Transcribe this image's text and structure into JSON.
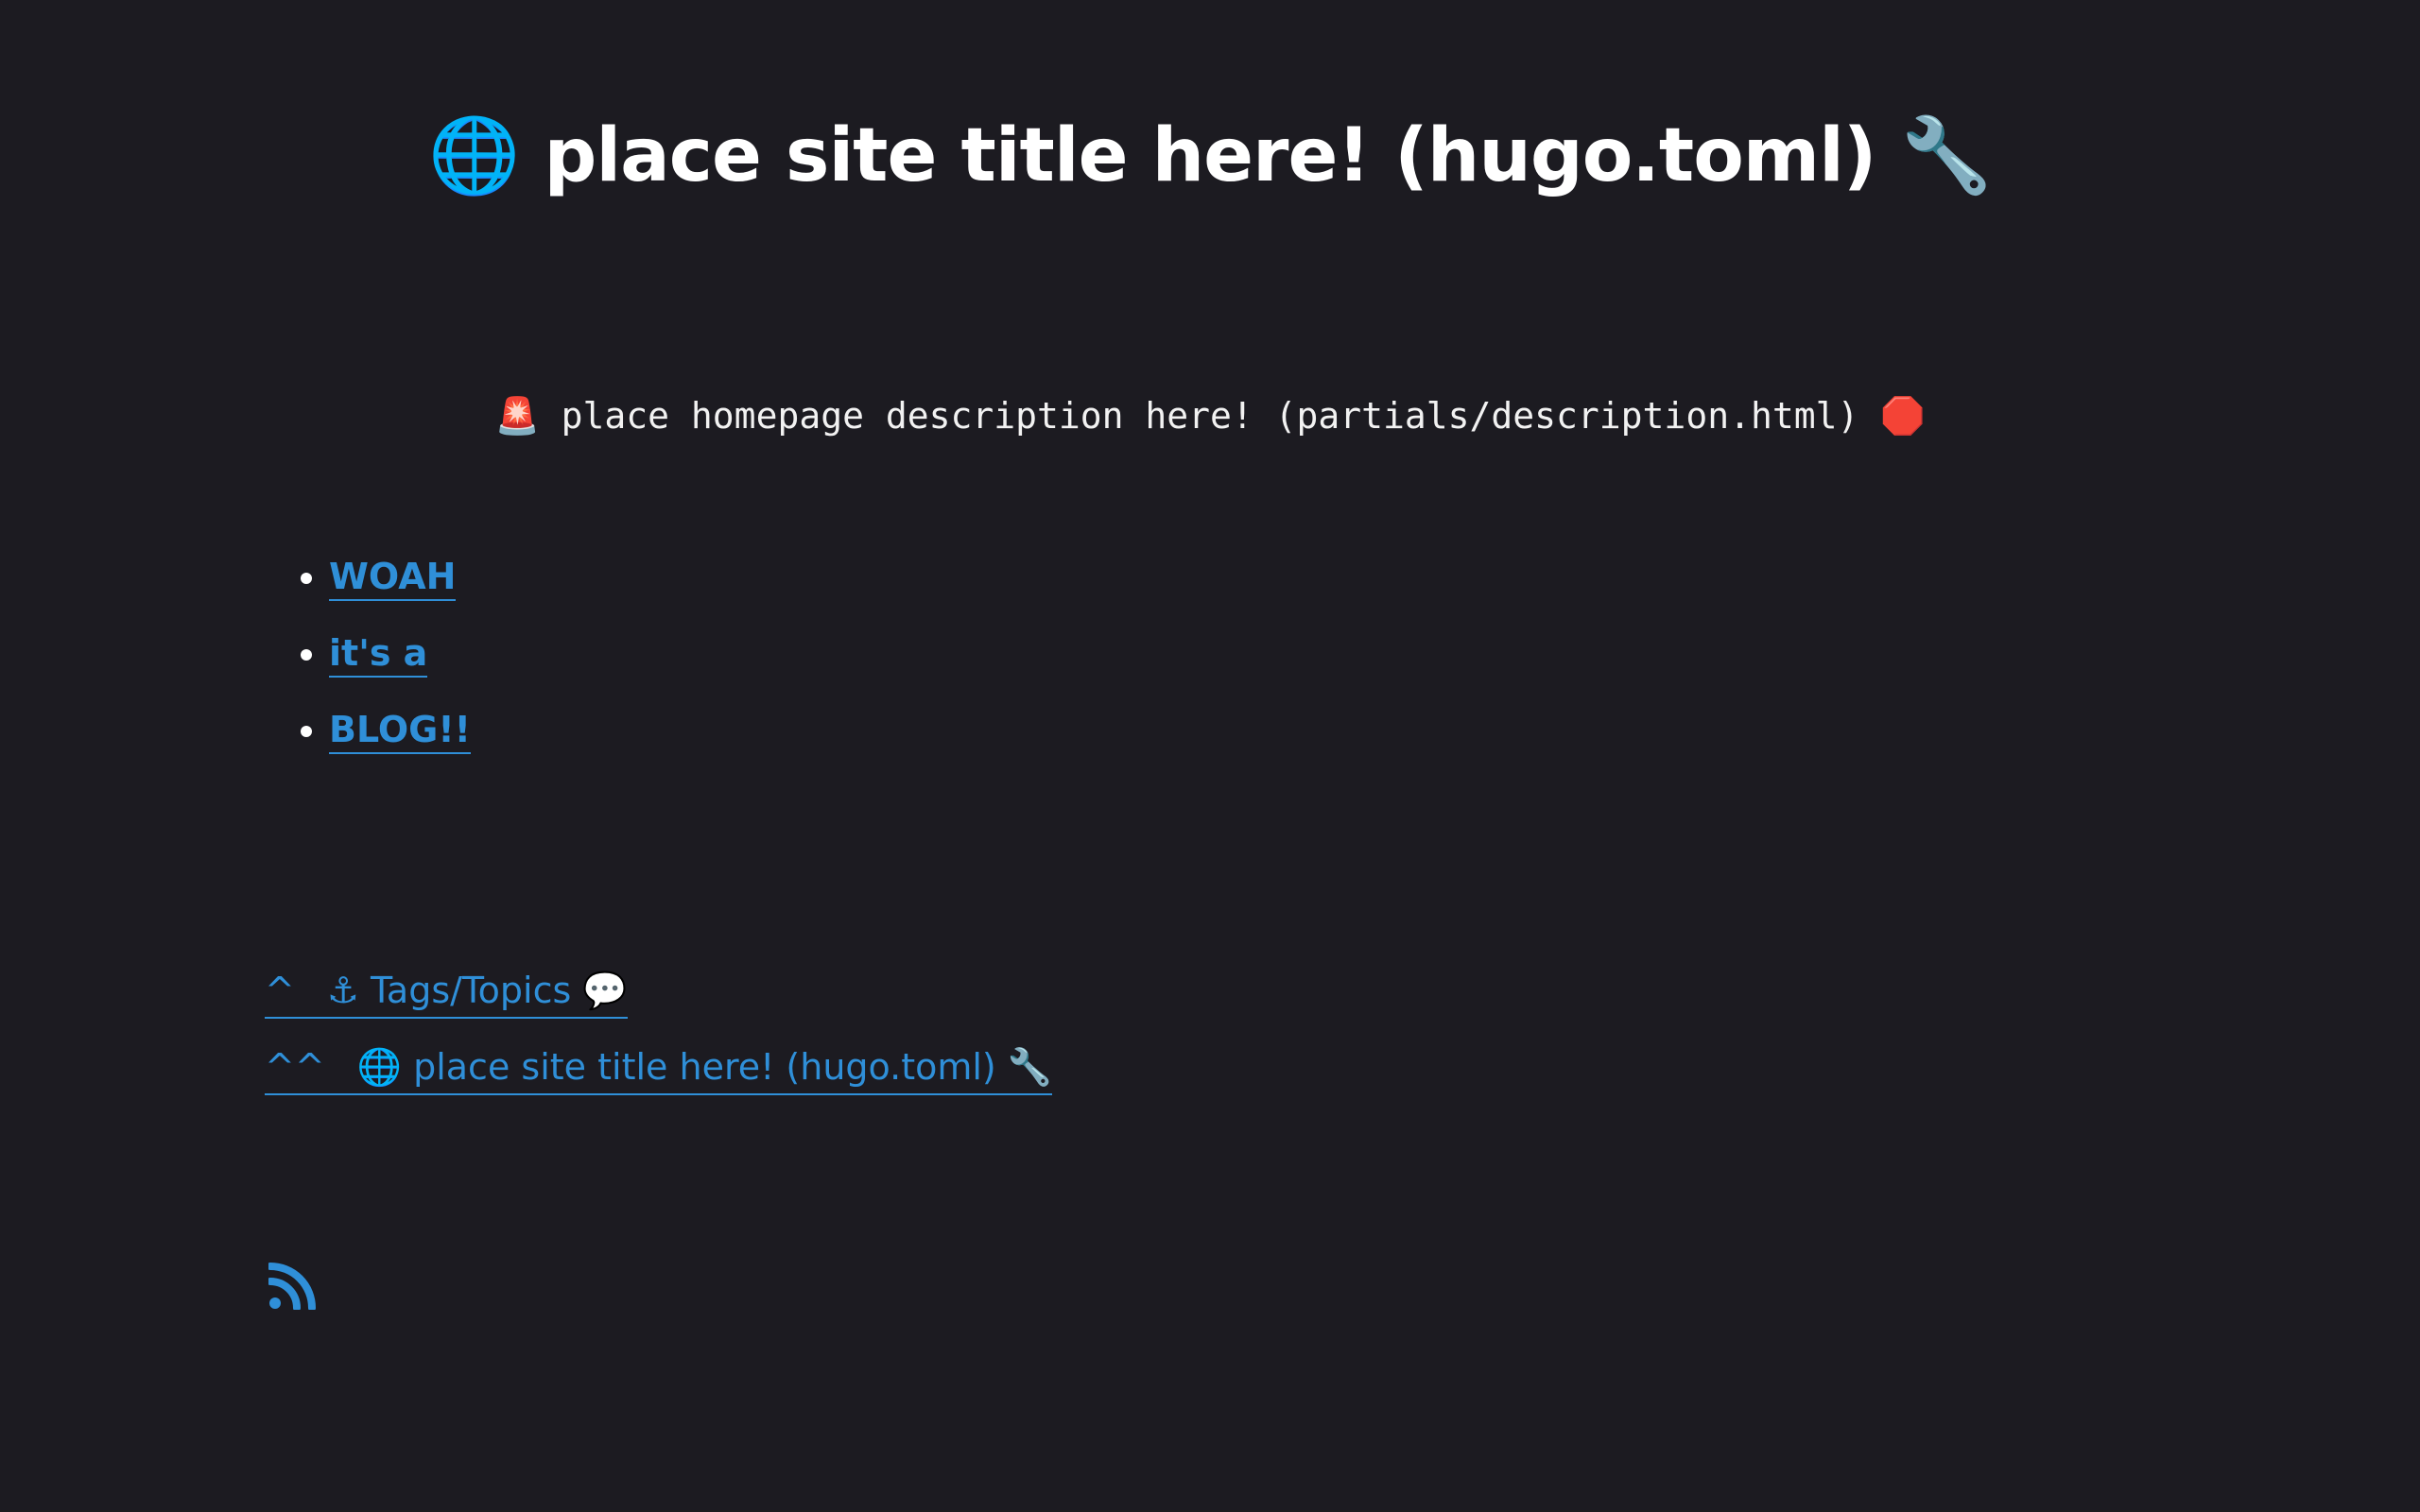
{
  "header": {
    "title": "🌐 place site title here! (hugo.toml) 🔧"
  },
  "description": {
    "text": "🚨 place homepage description here! (partials/description.html) 🛑"
  },
  "posts": [
    {
      "label": "WOAH"
    },
    {
      "label": "it's a"
    },
    {
      "label": "BLOG!!"
    }
  ],
  "nav": {
    "tags": {
      "caret": "^",
      "label": "⚓ Tags/Topics 💬"
    },
    "home": {
      "caret": "^^",
      "label": "🌐 place site title here! (hugo.toml) 🔧"
    }
  },
  "footer": {
    "rss_icon": "rss-icon"
  },
  "colors": {
    "background": "#1c1b21",
    "link": "#2f8fd8",
    "text": "#ffffff"
  }
}
